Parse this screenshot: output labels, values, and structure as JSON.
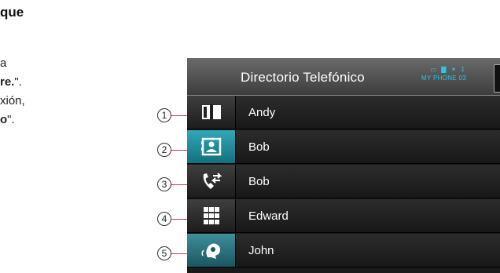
{
  "document": {
    "heading_fragment": "que",
    "line1": "a",
    "line2_bold": "re.",
    "line2_rest": "\".",
    "line3": "xión,",
    "line4_bold": "o",
    "line4_rest": "\"."
  },
  "screen": {
    "title": "Directorio Telefónico",
    "status_icons": "▭ ▇ ✶ 1",
    "phone_name": "MY PHONE 03",
    "side_tabs": [
      {
        "icon": "phonebook-icon",
        "state": "selected-dark"
      },
      {
        "icon": "contact-card-icon",
        "state": "active"
      },
      {
        "icon": "call-history-icon",
        "state": "normal"
      },
      {
        "icon": "keypad-icon",
        "state": "normal"
      },
      {
        "icon": "voice-dial-icon",
        "state": "teal"
      }
    ],
    "contacts": [
      "Andy",
      "Bob",
      "Bob",
      "Edward",
      "John"
    ]
  },
  "callouts": [
    "1",
    "2",
    "3",
    "4",
    "5"
  ],
  "colors": {
    "accent": "#27c9e0",
    "active_tab": "#1f8d9c",
    "callout_line": "#c23a5a"
  }
}
